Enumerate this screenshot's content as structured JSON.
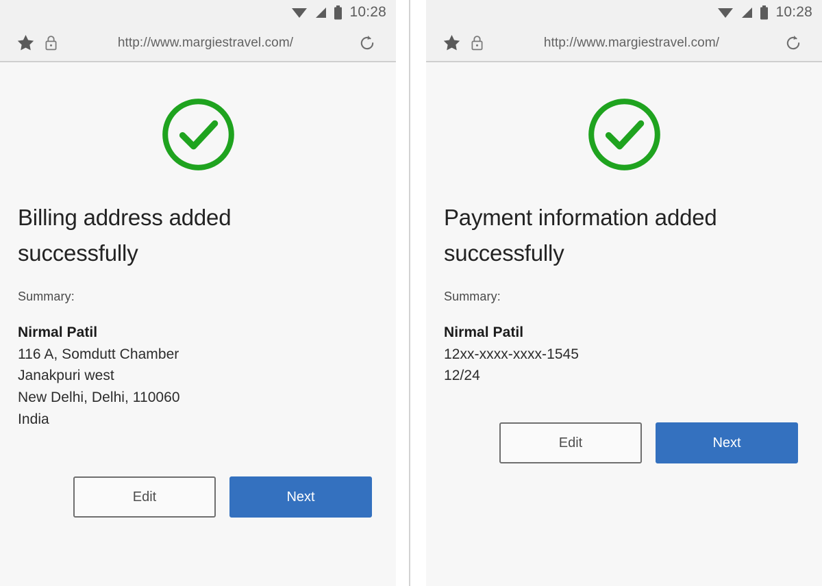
{
  "status_bar": {
    "time": "10:28",
    "icons": [
      "wifi-icon",
      "cellular-signal-icon",
      "battery-icon"
    ]
  },
  "browser_toolbar": {
    "url": "http://www.margiestravel.com/",
    "icons": [
      "star-icon",
      "lock-icon",
      "refresh-icon"
    ]
  },
  "colors": {
    "success_green": "#1fa31f",
    "primary_blue": "#3471bf",
    "page_background": "#f7f7f7",
    "chrome_background": "#f1f1f1"
  },
  "panels": [
    {
      "id": "billing-address-confirmation",
      "success_icon": "check-circle-icon",
      "headline": "Billing address added successfully",
      "summary_label": "Summary:",
      "summary_lines": [
        "Nirmal Patil",
        "116 A, Somdutt Chamber",
        "Janakpuri west",
        "New Delhi, Delhi, 110060",
        "India"
      ],
      "buttons": {
        "secondary": "Edit",
        "primary": "Next"
      }
    },
    {
      "id": "payment-information-confirmation",
      "success_icon": "check-circle-icon",
      "headline": "Payment information added successfully",
      "summary_label": "Summary:",
      "summary_lines": [
        "Nirmal Patil",
        "12xx-xxxx-xxxx-1545",
        "12/24"
      ],
      "buttons": {
        "secondary": "Edit",
        "primary": "Next"
      }
    }
  ]
}
